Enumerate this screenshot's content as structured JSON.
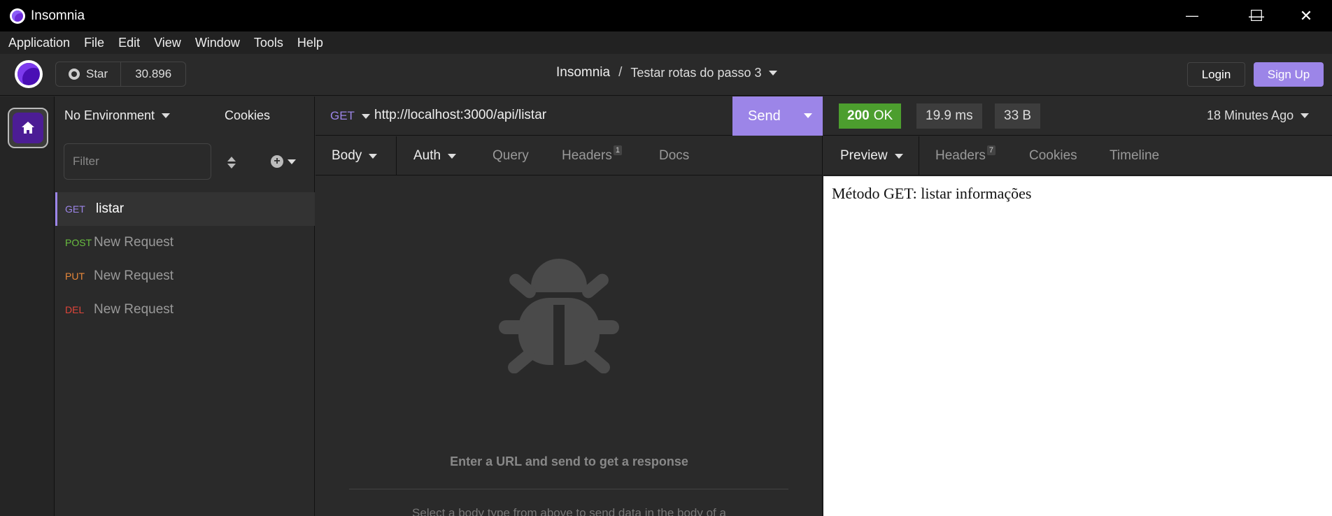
{
  "window": {
    "title": "Insomnia",
    "minimize_glyph": "—",
    "maximize_glyph": "☐",
    "close_glyph": "✕"
  },
  "menu": [
    "Application",
    "File",
    "Edit",
    "View",
    "Window",
    "Tools",
    "Help"
  ],
  "toolbar": {
    "star_label": "Star",
    "star_count": "30.896",
    "breadcrumb_root": "Insomnia",
    "breadcrumb_sep": "/",
    "breadcrumb_current": "Testar rotas do passo 3",
    "login_label": "Login",
    "signup_label": "Sign Up"
  },
  "sidebar": {
    "environment": "No Environment",
    "cookies_label": "Cookies",
    "filter_placeholder": "Filter",
    "requests": [
      {
        "method": "GET",
        "name": "listar",
        "method_color": "#9c85e8",
        "active": true
      },
      {
        "method": "POST",
        "name": "New Request",
        "method_color": "#6abf40",
        "active": false
      },
      {
        "method": "PUT",
        "name": "New Request",
        "method_color": "#e8883a",
        "active": false
      },
      {
        "method": "DEL",
        "name": "New Request",
        "method_color": "#e0453a",
        "active": false
      }
    ]
  },
  "request": {
    "method": "GET",
    "method_color": "#9c85e8",
    "url": "http://localhost:3000/api/listar",
    "send_label": "Send",
    "tabs": {
      "body": "Body",
      "auth": "Auth",
      "query": "Query",
      "headers": "Headers",
      "headers_count": "1",
      "docs": "Docs"
    },
    "empty_message": "Enter a URL and send to get a response",
    "empty_sub": "Select a body type from above to send data in the body of a"
  },
  "response": {
    "status_code": "200",
    "status_text": "OK",
    "status_color": "#4c9e2e",
    "time": "19.9 ms",
    "size": "33 B",
    "time_ago": "18 Minutes Ago",
    "tabs": {
      "preview": "Preview",
      "headers": "Headers",
      "headers_count": "7",
      "cookies": "Cookies",
      "timeline": "Timeline"
    },
    "body_text": "Método GET: listar informações"
  },
  "colors": {
    "accent": "#9c85e8",
    "brand": "#4c1d95"
  }
}
